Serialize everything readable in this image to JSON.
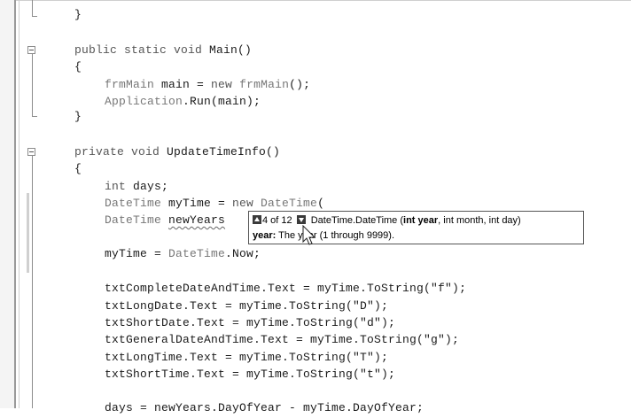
{
  "code": {
    "l1": "}",
    "l2_kw": "public static void",
    "l2_rest": " Main()",
    "l3": "{",
    "l4_a": "frmMain",
    "l4_b": " main = ",
    "l4_c": "new",
    "l4_d": " ",
    "l4_e": "frmMain",
    "l4_f": "();",
    "l5_a": "Application",
    "l5_b": ".Run(main);",
    "l6": "}",
    "l7_kw": "private void",
    "l7_rest": " UpdateTimeInfo()",
    "l8": "{",
    "l9_kw": "int",
    "l9_rest": " days;",
    "l10_ty": "DateTime",
    "l10_b": " myTime = ",
    "l10_kw": "new",
    "l10_ty2": " DateTime",
    "l10_end": "(",
    "l11_ty": "DateTime",
    "l11_sp": " ",
    "l11_var": "newYears",
    "l12_a": "myTime = ",
    "l12_ty": "DateTime",
    "l12_b": ".Now;",
    "l13": "txtCompleteDateAndTime.Text = myTime.ToString(\"f\");",
    "l14": "txtLongDate.Text = myTime.ToString(\"D\");",
    "l15": "txtShortDate.Text = myTime.ToString(\"d\");",
    "l16": "txtGeneralDateAndTime.Text = myTime.ToString(\"g\");",
    "l17": "txtLongTime.Text = myTime.ToString(\"T\");",
    "l18": "txtShortTime.Text = myTime.ToString(\"t\");",
    "l19": "days = newYears.DayOfYear - myTime.DayOfYear;"
  },
  "tooltip": {
    "counter": "4 of 12",
    "sig_pre": "DateTime.DateTime (",
    "sig_bold": "int year",
    "sig_post": ", int month, int day)",
    "param_name": "year:",
    "param_desc": " The year (1 through 9999)."
  }
}
